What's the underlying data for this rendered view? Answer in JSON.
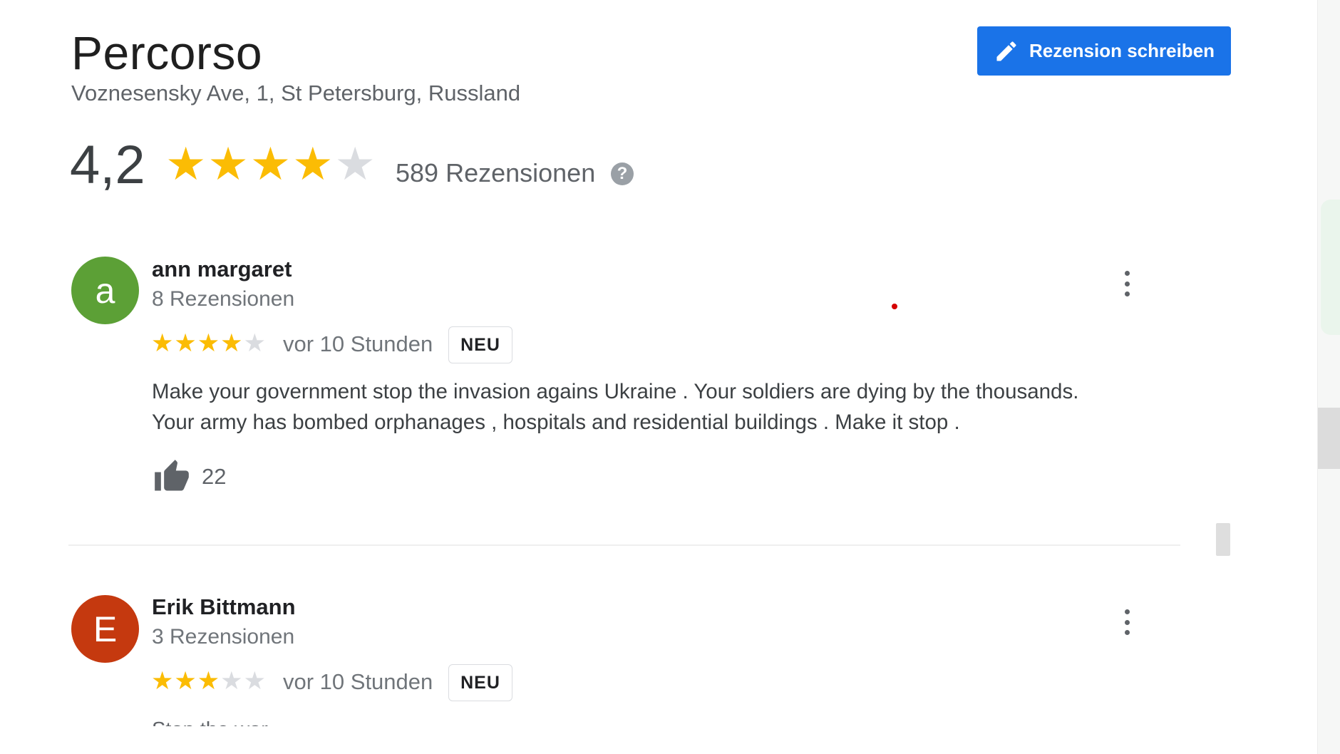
{
  "place": {
    "name": "Percorso",
    "address": "Voznesensky Ave, 1, St Petersburg, Russland"
  },
  "actions": {
    "write_review_label": "Rezension schreiben",
    "write_review_icon": "pencil-icon"
  },
  "summary": {
    "rating_text": "4,2",
    "rating_value": 4.2,
    "review_count_text": "589 Rezensionen",
    "help_icon": "help-icon"
  },
  "colors": {
    "accent_blue": "#1a73e8",
    "star_filled": "#fbbc04",
    "star_empty": "#dadce0"
  },
  "reviews": [
    {
      "avatar_letter": "a",
      "avatar_color": "#5ca036",
      "name": "ann margaret",
      "subtitle": "8 Rezensionen",
      "rating": 4,
      "time": "vor 10 Stunden",
      "badge": "NEU",
      "text_line1": "Make your government stop the invasion agains Ukraine . Your soldiers are dying by the thousands.",
      "text_line2": "Your army has bombed orphanages , hospitals and residential buildings . Make it stop .",
      "likes": "22"
    },
    {
      "avatar_letter": "E",
      "avatar_color": "#c5390f",
      "name": "Erik Bittmann",
      "subtitle": "3 Rezensionen",
      "rating": 3,
      "time": "vor 10 Stunden",
      "badge": "NEU",
      "text_partial": "Stop the war"
    }
  ]
}
